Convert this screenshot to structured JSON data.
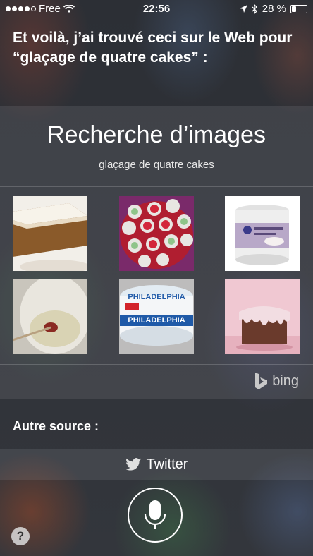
{
  "status_bar": {
    "carrier": "Free",
    "time": "22:56",
    "battery_percent": "28 %",
    "battery_level": 0.28,
    "icons": [
      "signal-dots-icon",
      "wifi-icon",
      "location-arrow-icon",
      "bluetooth-icon",
      "battery-icon"
    ]
  },
  "siri": {
    "answer": "Et voilà, j’ai trouvé ceci sur le Web pour “glaçage de quatre cakes” :"
  },
  "image_search": {
    "title": "Recherche d’images",
    "query": "glaçage de quatre cakes",
    "images": [
      {
        "subject": "cake slice with white frosting"
      },
      {
        "subject": "frosted cookies on red plate"
      },
      {
        "subject": "frosting tub"
      },
      {
        "subject": "glaze in glass bowl"
      },
      {
        "subject": "Philadelphia cream cheese tub",
        "label": "PHILADELPHIA"
      },
      {
        "subject": "loaf cake with pink glaze"
      }
    ],
    "provider": "bing"
  },
  "other_source": {
    "label": "Autre source :",
    "twitter_label": "Twitter"
  },
  "controls": {
    "help_label": "?",
    "icons": [
      "microphone-icon",
      "help-icon",
      "twitter-icon",
      "bing-logo-icon"
    ]
  }
}
